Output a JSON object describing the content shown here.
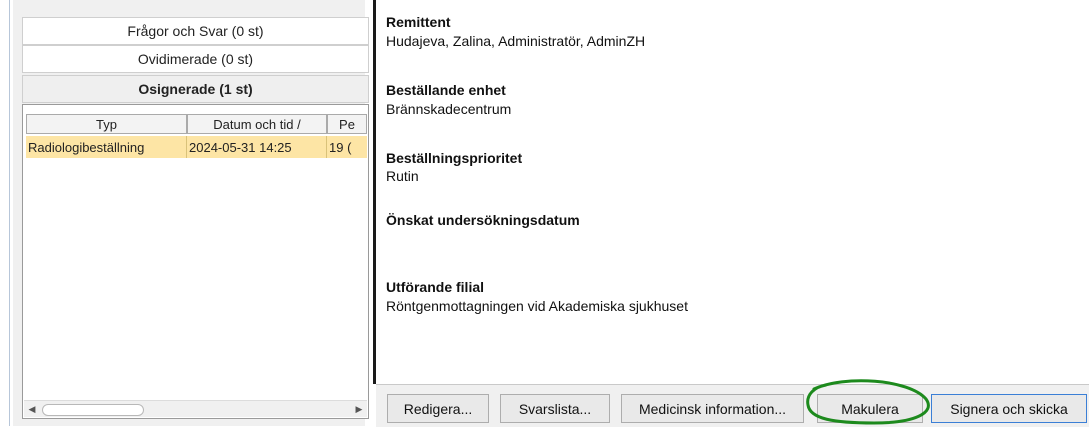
{
  "accordion": {
    "questions": "Frågor och Svar  (0 st)",
    "unvidimated": "Ovidimerade  (0 st)",
    "unsigned": "Osignerade  (1 st)"
  },
  "table": {
    "columns": [
      "Typ",
      "Datum och tid /",
      "Pe"
    ],
    "rows": [
      [
        "Radiologibeställning",
        "2024-05-31 14:25",
        "19 ("
      ]
    ]
  },
  "details": {
    "remittent_label": "Remittent",
    "remittent_value": "Hudajeva, Zalina, Administratör, AdminZH",
    "unit_label": "Beställande enhet",
    "unit_value": "Brännskadecentrum",
    "priority_label": "Beställningsprioritet",
    "priority_value": "Rutin",
    "date_label": "Önskat undersökningsdatum",
    "branch_label": "Utförande filial",
    "branch_value": "Röntgenmottagningen vid Akademiska sjukhuset"
  },
  "buttons": {
    "edit": "Redigera...",
    "answers": "Svarslista...",
    "medinfo": "Medicinsk information...",
    "cancel": "Makulera",
    "sign": "Signera och skicka"
  },
  "colors": {
    "selected_row": "#fde5a5",
    "annotation": "#1d8a1d",
    "primary_border": "#3b7fd6"
  }
}
